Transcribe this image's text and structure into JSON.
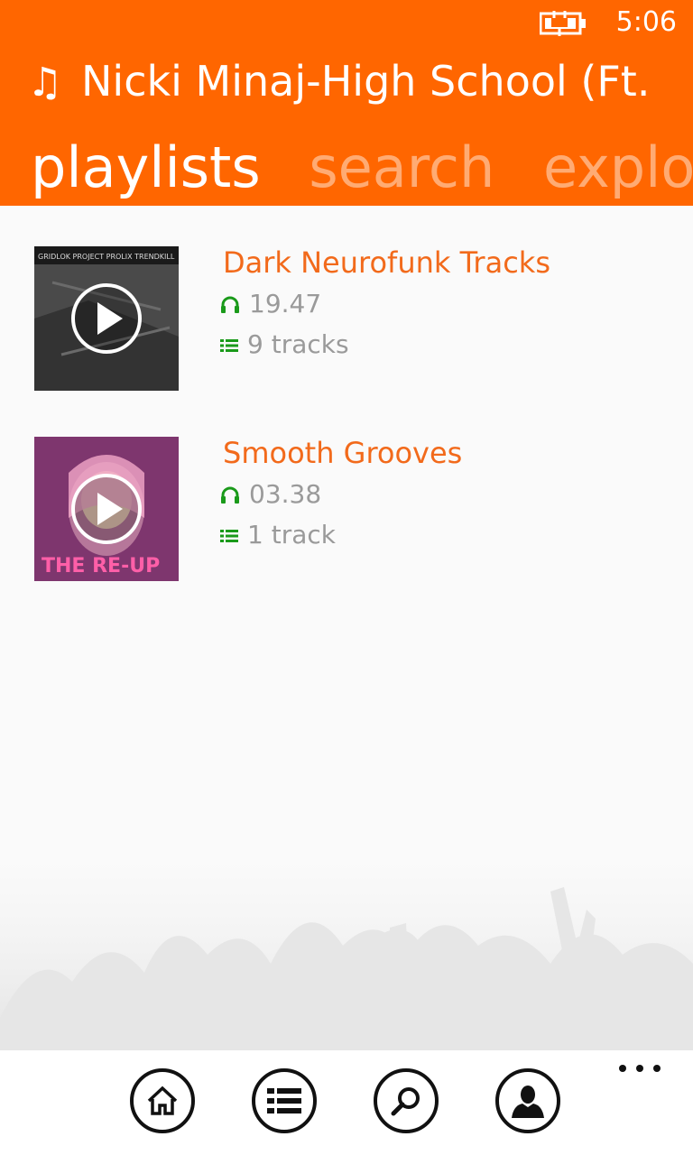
{
  "status": {
    "time": "5:06",
    "battery_icon": "battery-charging-icon"
  },
  "now_playing": {
    "icon": "music-note-icon",
    "title": "Nicki Minaj-High School (Ft."
  },
  "pivot": {
    "tabs": [
      "playlists",
      "search",
      "explore"
    ]
  },
  "playlists": [
    {
      "title": "Dark Neurofunk Tracks",
      "duration": "19.47",
      "tracks": "9 tracks",
      "cover_text": "GRIDLOK PROJECT PROLIX TRENDKILL"
    },
    {
      "title": "Smooth Grooves",
      "duration": "03.38",
      "tracks": "1 track",
      "cover_text": "THE RE-UP"
    }
  ],
  "app_bar": {
    "buttons": [
      "home-icon",
      "list-icon",
      "search-icon",
      "profile-icon"
    ],
    "more": "more-icon"
  },
  "colors": {
    "accent": "#ff6600",
    "title": "#f26a1b",
    "meta_icon": "#1a9a1a",
    "meta_text": "#9a9a9a"
  }
}
